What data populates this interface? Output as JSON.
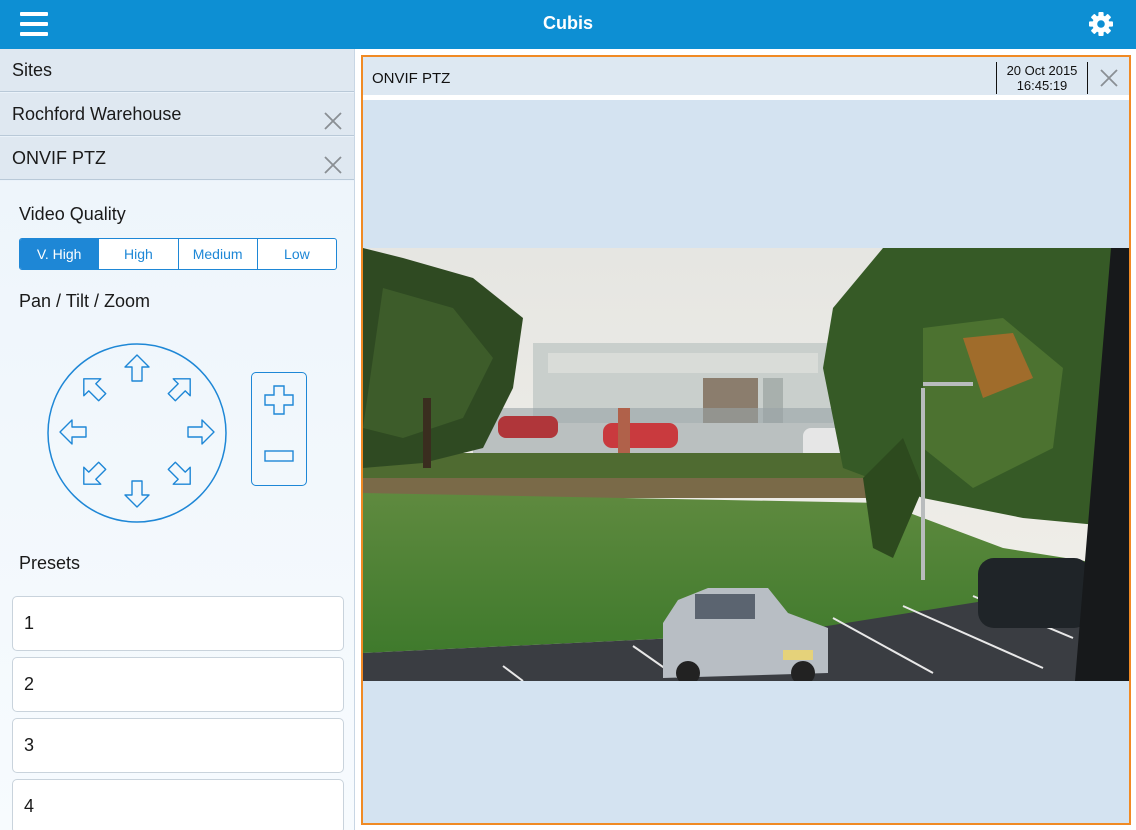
{
  "header": {
    "title": "Cubis",
    "menu_icon": "hamburger-menu-icon",
    "settings_icon": "gear-icon"
  },
  "sidebar": {
    "breadcrumbs": [
      {
        "label": "Sites"
      },
      {
        "label": "Rochford Warehouse",
        "closable": true
      },
      {
        "label": "ONVIF PTZ",
        "closable": true
      }
    ],
    "video_quality": {
      "title": "Video Quality",
      "options": [
        "V. High",
        "High",
        "Medium",
        "Low"
      ],
      "selected": "V. High"
    },
    "ptz": {
      "title": "Pan / Tilt / Zoom",
      "directions": [
        "up",
        "up-right",
        "right",
        "down-right",
        "down",
        "down-left",
        "left",
        "up-left"
      ],
      "zoom_controls": [
        "zoom-in",
        "zoom-out"
      ]
    },
    "presets": {
      "title": "Presets",
      "items": [
        "1",
        "2",
        "3",
        "4"
      ]
    }
  },
  "camera_tile": {
    "title": "ONVIF PTZ",
    "date": "20 Oct 2015",
    "time": "16:45:19",
    "border_color": "#f08a24"
  },
  "colors": {
    "brand": "#0d8fd3",
    "accent": "#1e87d6",
    "selection": "#f08a24"
  }
}
